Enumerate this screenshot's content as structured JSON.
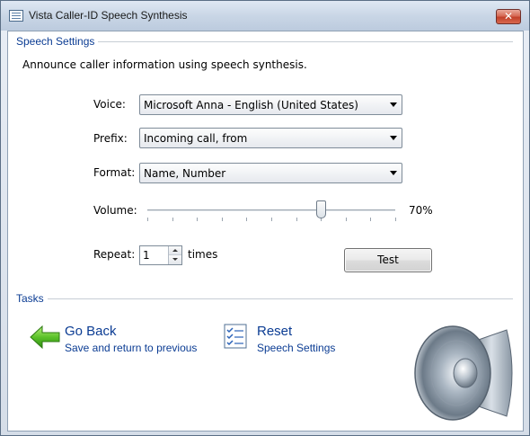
{
  "window": {
    "title": "Vista Caller-ID Speech Synthesis",
    "close_glyph": "✕"
  },
  "speech_settings": {
    "group_title": "Speech Settings",
    "description": "Announce caller information using speech synthesis.",
    "voice": {
      "label": "Voice:",
      "value": "Microsoft Anna - English (United States)"
    },
    "prefix": {
      "label": "Prefix:",
      "value": "Incoming call, from"
    },
    "format": {
      "label": "Format:",
      "value": "Name, Number"
    },
    "volume": {
      "label": "Volume:",
      "value_text": "70%",
      "level": 0.7
    },
    "repeat": {
      "label": "Repeat:",
      "value": "1",
      "unit": "times"
    },
    "test_button": "Test"
  },
  "tasks": {
    "group_title": "Tasks",
    "go_back": {
      "title": "Go Back",
      "subtitle": "Save and return to previous",
      "icon": "green-back-arrow-icon"
    },
    "reset": {
      "title": "Reset",
      "subtitle": "Speech Settings",
      "icon": "checklist-icon"
    }
  },
  "decor": {
    "icon": "speaker-icon"
  }
}
